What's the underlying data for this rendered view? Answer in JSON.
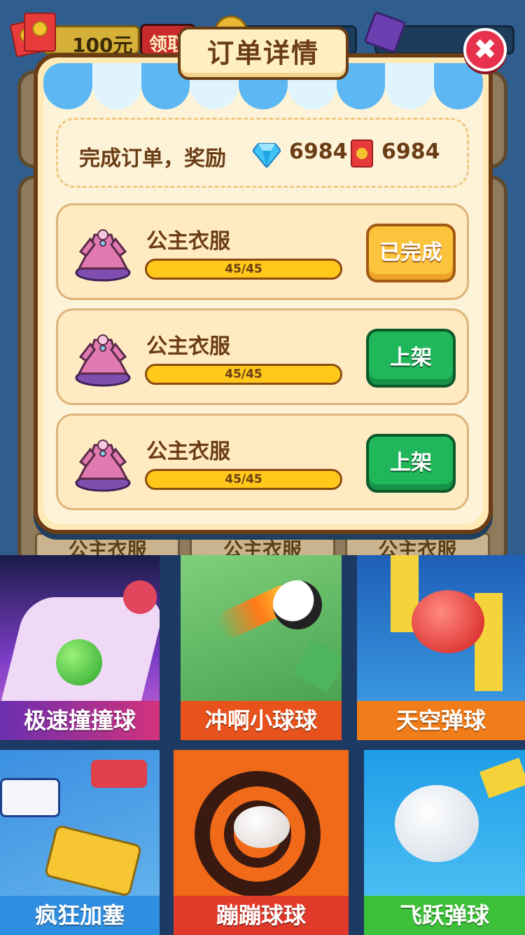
{
  "header": {
    "money": "100元",
    "claim_label": "领取"
  },
  "dialog": {
    "title": "订单详情",
    "reward": {
      "label": "完成订单，奖励",
      "diamond_value": "6984",
      "redpacket_value": "6984"
    },
    "orders": [
      {
        "name": "公主衣服",
        "progress_text": "45/45",
        "progress": 1.0,
        "button": "已完成",
        "button_style": "done"
      },
      {
        "name": "公主衣服",
        "progress_text": "45/45",
        "progress": 1.0,
        "button": "上架",
        "button_style": "shelf"
      },
      {
        "name": "公主衣服",
        "progress_text": "45/45",
        "progress": 1.0,
        "button": "上架",
        "button_style": "shelf"
      }
    ],
    "close_icon": "close-icon"
  },
  "background_cards": [
    "公主衣服",
    "公主衣服",
    "公主衣服"
  ],
  "ads": [
    {
      "label": "极速撞撞球",
      "color": "#8a3fd0"
    },
    {
      "label": "冲啊小球球",
      "color": "#5fb05a"
    },
    {
      "label": "天空弹球",
      "color": "#3e8fd8"
    },
    {
      "label": "疯狂加塞",
      "color": "#3f8ad6"
    },
    {
      "label": "蹦蹦球球",
      "color": "#e8531d"
    },
    {
      "label": "飞跃弹球",
      "color": "#2bb0e8"
    }
  ],
  "colors": {
    "dialog_border": "#6b3d15",
    "done_button": "#fcc43c",
    "shelf_button": "#1fb75a",
    "close_button": "#e8324d"
  }
}
